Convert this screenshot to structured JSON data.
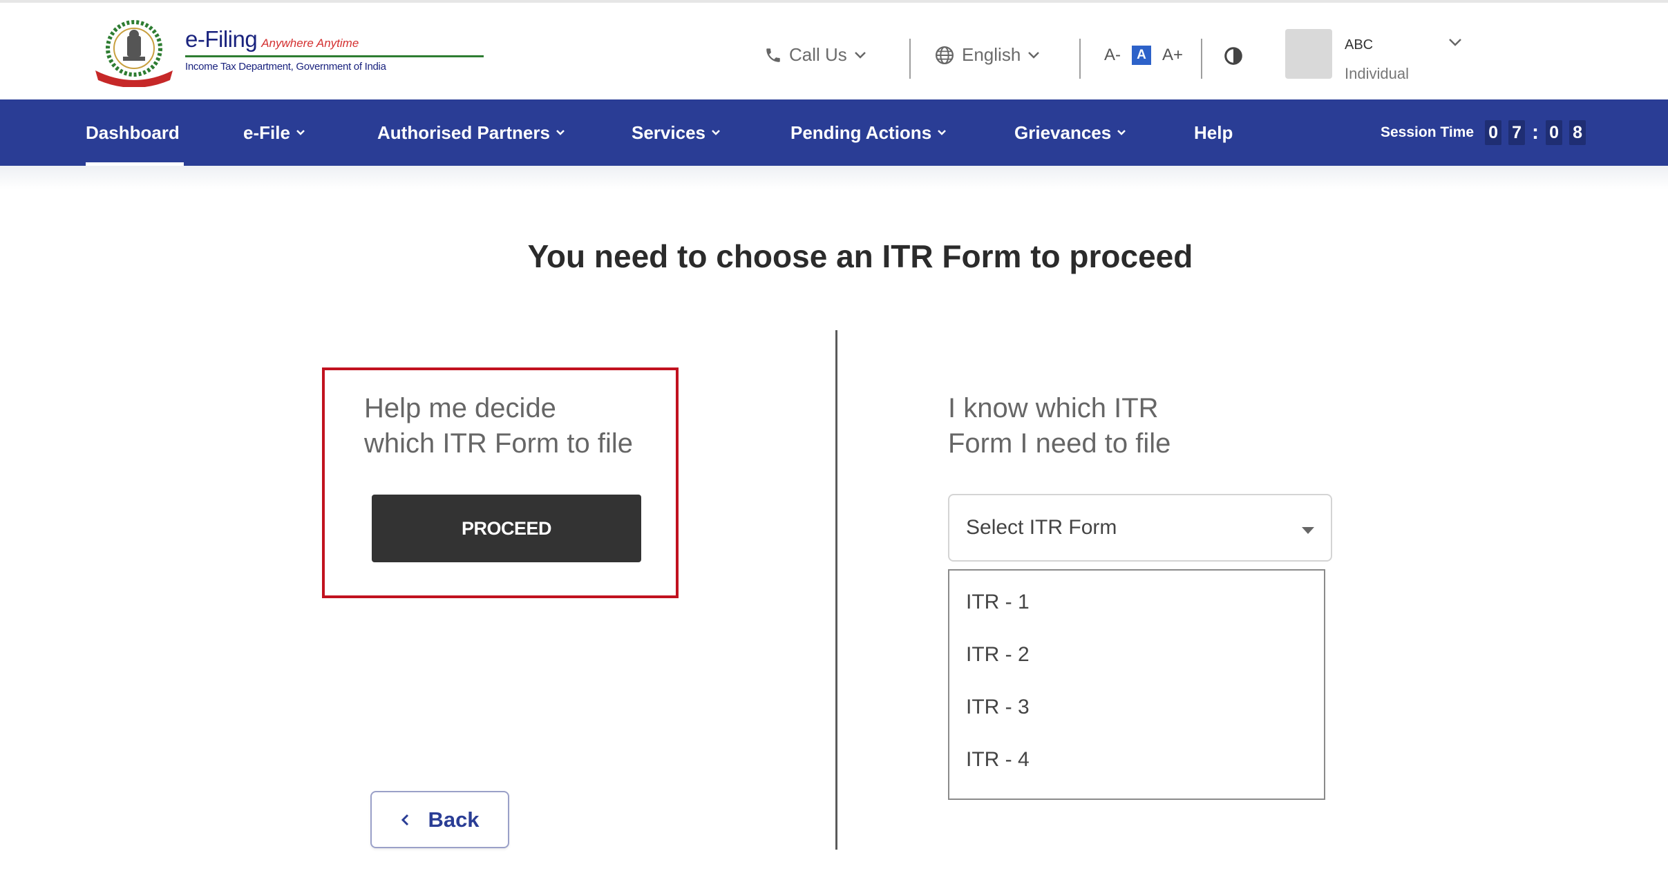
{
  "header": {
    "brand": {
      "name": "e-Filing",
      "tagline": "Anywhere Anytime",
      "subtitle": "Income Tax Department, Government of India"
    },
    "call_us": {
      "label": "Call Us",
      "icon": "phone-icon"
    },
    "language": {
      "label": "English",
      "icon": "globe-icon"
    },
    "font_controls": {
      "decrease": "A-",
      "default": "A",
      "increase": "A+"
    },
    "contrast_icon": "contrast-icon",
    "user": {
      "name": "ABC",
      "type": "Individual"
    }
  },
  "nav": {
    "items": [
      {
        "label": "Dashboard",
        "active": true,
        "dropdown": false
      },
      {
        "label": "e-File",
        "active": false,
        "dropdown": true
      },
      {
        "label": "Authorised Partners",
        "active": false,
        "dropdown": true
      },
      {
        "label": "Services",
        "active": false,
        "dropdown": true
      },
      {
        "label": "Pending Actions",
        "active": false,
        "dropdown": true
      },
      {
        "label": "Grievances",
        "active": false,
        "dropdown": true
      },
      {
        "label": "Help",
        "active": false,
        "dropdown": false
      }
    ],
    "session": {
      "label": "Session Time",
      "digits": [
        "0",
        "7",
        "0",
        "8"
      ]
    }
  },
  "main": {
    "title": "You need to choose an ITR Form to proceed",
    "help_option": {
      "line1": "Help me decide",
      "line2": "which ITR Form to file",
      "button": "PROCEED"
    },
    "know_option": {
      "line1": "I know which ITR",
      "line2": "Form I need to file",
      "select_placeholder": "Select ITR Form",
      "options": [
        "ITR - 1",
        "ITR - 2",
        "ITR - 3",
        "ITR - 4"
      ]
    },
    "back_button": "Back"
  },
  "colors": {
    "nav_bg": "#2a3d95",
    "highlight_border": "#c1121f",
    "proceed_bg": "#333333",
    "font_active": "#2d62c9"
  }
}
